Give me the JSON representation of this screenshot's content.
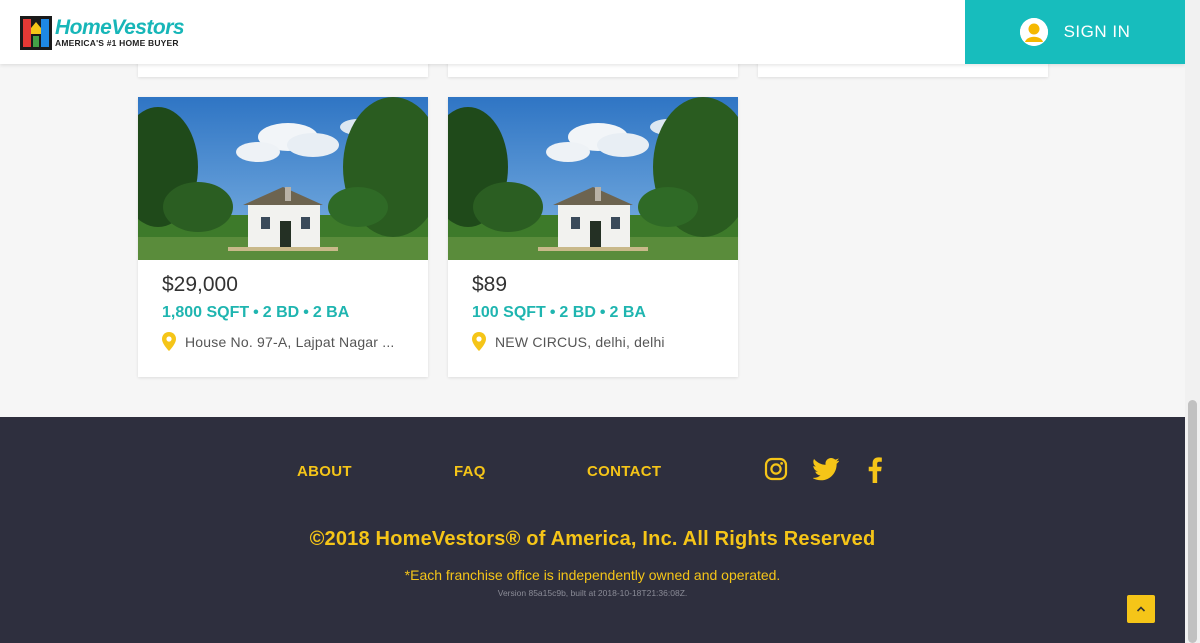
{
  "header": {
    "logo_name": "HomeVestors",
    "logo_tagline": "AMERICA'S #1 HOME BUYER",
    "signin_label": "SIGN IN"
  },
  "listings": [
    {
      "price": "$29,000",
      "sqft": "1,800 SQFT",
      "beds": "2 BD",
      "baths": "2 BA",
      "address": "House No. 97-A, Lajpat Nagar ..."
    },
    {
      "price": "$89",
      "sqft": "100 SQFT",
      "beds": "2 BD",
      "baths": "2 BA",
      "address": "NEW CIRCUS, delhi, delhi"
    }
  ],
  "footer": {
    "nav": [
      "ABOUT",
      "FAQ",
      "CONTACT"
    ],
    "social_icons": [
      "instagram-icon",
      "twitter-icon",
      "facebook-icon"
    ],
    "copyright": "©2018 HomeVestors® of America, Inc. All Rights Reserved",
    "franchise_note": "*Each franchise office is independently owned and operated.",
    "version": "Version 85a15c9b, built at 2018-10-18T21:36:08Z."
  },
  "colors": {
    "accent_teal": "#17bdbd",
    "footer_bg": "#2e2f3e",
    "footer_yellow": "#f5c518"
  }
}
